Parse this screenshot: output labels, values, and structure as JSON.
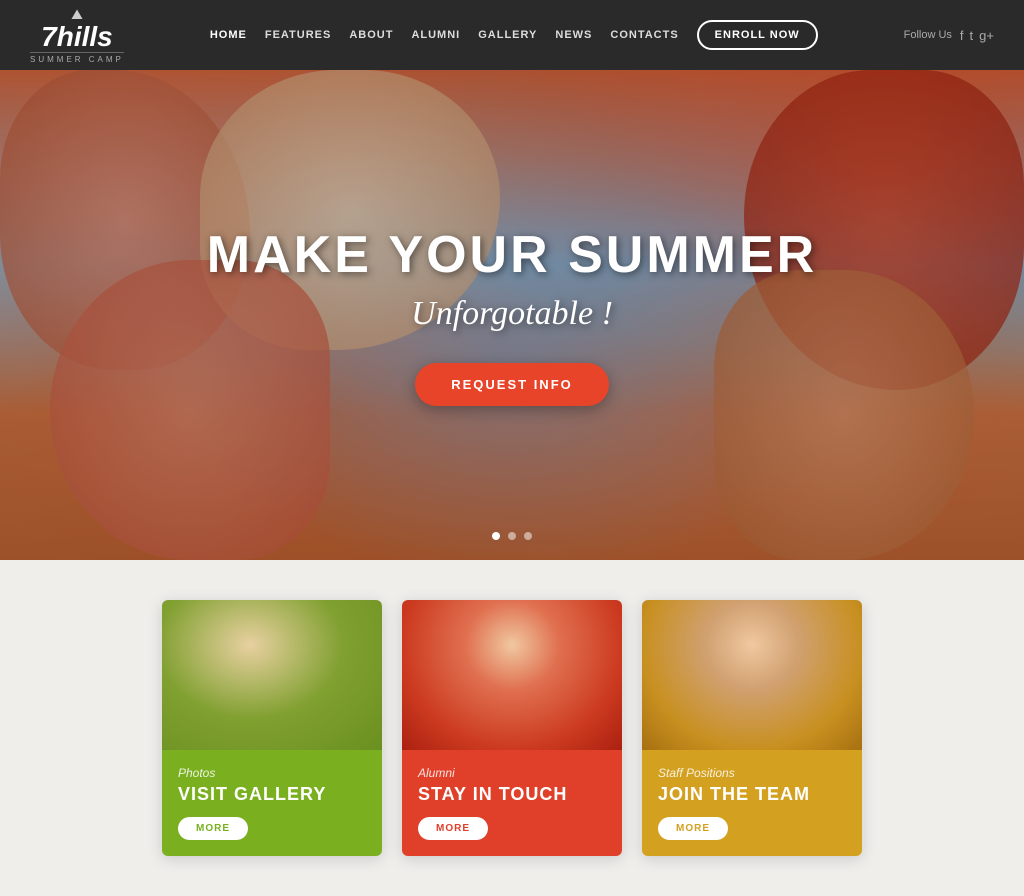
{
  "header": {
    "logo_text": "7hills",
    "logo_sub": "SUMMER CAMP",
    "follow_us": "Follow Us",
    "enroll_label": "ENROLL NOW",
    "social_icons": [
      "f",
      "t",
      "g"
    ]
  },
  "nav": {
    "items": [
      {
        "label": "HOME",
        "active": true
      },
      {
        "label": "FEATURES",
        "active": false
      },
      {
        "label": "ABOUT",
        "active": false
      },
      {
        "label": "ALUMNI",
        "active": false
      },
      {
        "label": "GALLERY",
        "active": false
      },
      {
        "label": "NEWS",
        "active": false
      },
      {
        "label": "CONTACTS",
        "active": false
      }
    ]
  },
  "hero": {
    "title": "MAKE YOUR SUMMER",
    "subtitle": "Unforgotable !",
    "cta_label": "REQUEST INFO",
    "dots": [
      true,
      false,
      false
    ]
  },
  "cards": [
    {
      "category": "Photos",
      "title": "VISIT GALLERY",
      "more_label": "MORE",
      "color": "green"
    },
    {
      "category": "Alumni",
      "title": "STAY IN TOUCH",
      "more_label": "MORE",
      "color": "red"
    },
    {
      "category": "Staff Positions",
      "title": "JOIN THE TEAM",
      "more_label": "MORE",
      "color": "gold"
    }
  ]
}
